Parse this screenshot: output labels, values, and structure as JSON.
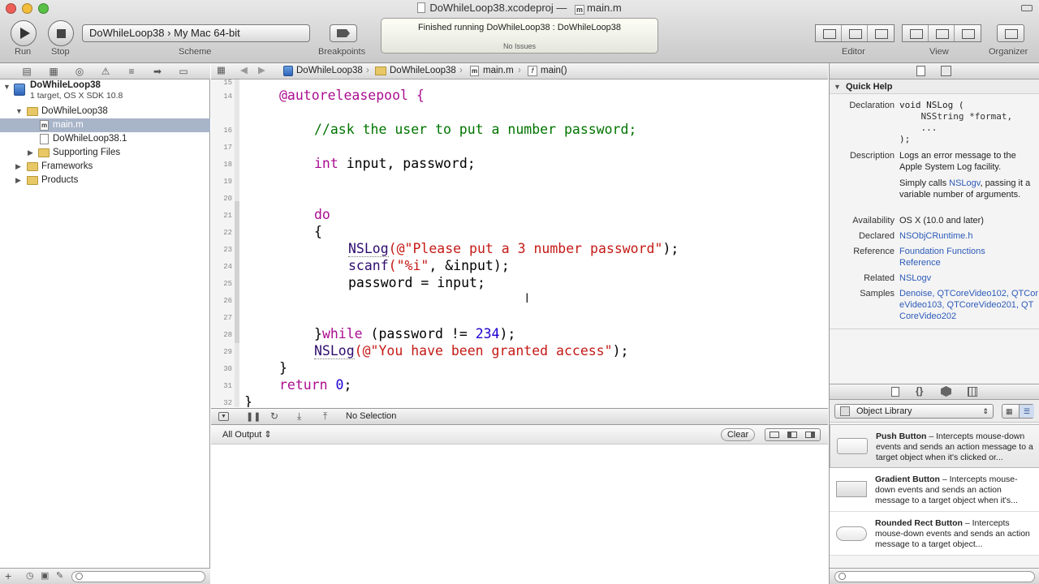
{
  "window": {
    "title_project": "DoWhileLoop38.xcodeproj",
    "title_sep": "—",
    "title_file": "main.m"
  },
  "toolbar": {
    "run_label": "Run",
    "stop_label": "Stop",
    "scheme_label": "Scheme",
    "scheme_target": "DoWhileLoop38",
    "scheme_sep": "›",
    "scheme_destination": "My Mac 64-bit",
    "breakpoints_label": "Breakpoints",
    "activity_status": "Finished running DoWhileLoop38 : DoWhileLoop38",
    "activity_issues": "No Issues",
    "editor_label": "Editor",
    "view_label": "View",
    "organizer_label": "Organizer"
  },
  "navigator": {
    "project_name": "DoWhileLoop38",
    "project_sub": "1 target, OS X SDK 10.8",
    "items": [
      {
        "label": "DoWhileLoop38"
      },
      {
        "label": "main.m"
      },
      {
        "label": "DoWhileLoop38.1"
      },
      {
        "label": "Supporting Files"
      },
      {
        "label": "Frameworks"
      },
      {
        "label": "Products"
      }
    ]
  },
  "jumpbar": {
    "crumbs": [
      "DoWhileLoop38",
      "DoWhileLoop38",
      "main.m",
      "main()"
    ]
  },
  "editor": {
    "line_numbers": [
      "15",
      "14",
      "16",
      "17",
      "18",
      "19",
      "20",
      "21",
      "22",
      "23",
      "24",
      "25",
      "26",
      "27",
      "28",
      "29",
      "30",
      "31",
      "32"
    ],
    "code": {
      "l14": "@autoreleasepool {",
      "l16": "//ask the user to put a number password;",
      "l18_kw": "int",
      "l18_rest": " input, password;",
      "l21": "do",
      "l22": "{",
      "l23_fn": "NSLog",
      "l23_str": "(@\"Please put a 3 number password\"",
      "l23_end": ");",
      "l24_fn": "scanf",
      "l24_str": "(\"%i\"",
      "l24_end": ", &input);",
      "l25": "password = input;",
      "l28_brace": "}",
      "l28_kw": "while",
      "l28_mid": " (password != ",
      "l28_num": "234",
      "l28_end": ");",
      "l29_fn": "NSLog",
      "l29_str": "(@\"You have been granted access\"",
      "l29_end": ");",
      "l30": "}",
      "l31_kw": "return",
      "l31_num": "0",
      "l31_end": ";",
      "l32": "}"
    }
  },
  "debug": {
    "selection": "No Selection",
    "output_filter": "All Output ⇕",
    "clear_label": "Clear"
  },
  "quick_help": {
    "title": "Quick Help",
    "declaration_label": "Declaration",
    "declaration_lines": [
      "void NSLog (",
      "    NSString *format,",
      "    ...",
      ");"
    ],
    "description_label": "Description",
    "description_1": "Logs an error message to the Apple System Log facility.",
    "description_2_pre": "Simply calls ",
    "description_2_link": "NSLogv",
    "description_2_post": ", passing it a variable number of arguments.",
    "availability_label": "Availability",
    "availability": "OS X (10.0 and later)",
    "declared_label": "Declared",
    "declared": "NSObjCRuntime.h",
    "reference_label": "Reference",
    "reference": "Foundation Functions Reference",
    "related_label": "Related",
    "related": "NSLogv",
    "samples_label": "Samples",
    "samples": "Denoise, QTCoreVideo102, QTCoreVideo103, QTCoreVideo201, QTCoreVideo202"
  },
  "library": {
    "selector": "Object Library",
    "items": [
      {
        "name": "Push Button",
        "desc": " – Intercepts mouse-down events and sends an action message to a target object when it's clicked or..."
      },
      {
        "name": "Gradient Button",
        "desc": " – Intercepts mouse-down events and sends an action message to a target object when it's..."
      },
      {
        "name": "Rounded Rect Button",
        "desc": " – Intercepts mouse-down events and sends an action message to a target object..."
      }
    ]
  },
  "colors": {
    "keyword": "#aa0d91",
    "string": "#c41a16",
    "comment": "#007400",
    "number": "#1c00cf",
    "selection": "#a8b4c8"
  }
}
